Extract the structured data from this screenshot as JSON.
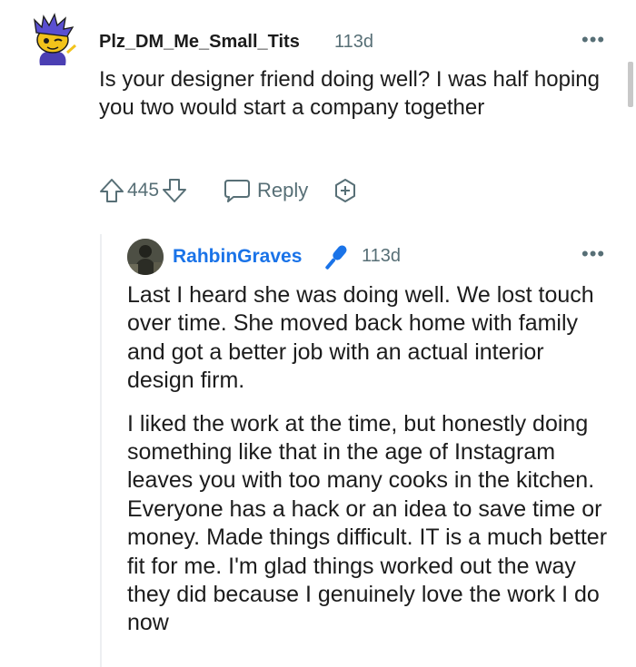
{
  "comment": {
    "username": "Plz_DM_Me_Small_Tits",
    "timestamp": "113d",
    "body": "Is your designer friend doing well? I was half hoping you two would start a company together",
    "votes": "445",
    "reply_label": "Reply",
    "avatar_icon": "snoo-avatar-icon",
    "upvote_icon": "upvote-arrow-icon",
    "downvote_icon": "downvote-arrow-icon",
    "reply_icon": "speech-bubble-icon",
    "award_icon": "award-plus-icon",
    "more_icon": "more-dots-icon"
  },
  "reply": {
    "username": "RahbinGraves",
    "timestamp": "113d",
    "badge_icon": "microphone-icon",
    "badge_color": "#1a73e8",
    "paragraphs": [
      "Last I heard she was doing well. We lost touch over time. She moved back home with family and got a better job with an actual interior design firm.",
      "I liked the work at the time, but honestly doing something like that in the age of Instagram leaves you with too many cooks in the kitchen. Everyone has a hack or an idea to save time or money. Made things difficult. IT is a much better fit for me. I'm glad things worked out the way they did because I genuinely love the work I do now"
    ]
  },
  "colors": {
    "text": "#1c1c1c",
    "meta": "#576f76",
    "accent": "#1a73e8"
  }
}
